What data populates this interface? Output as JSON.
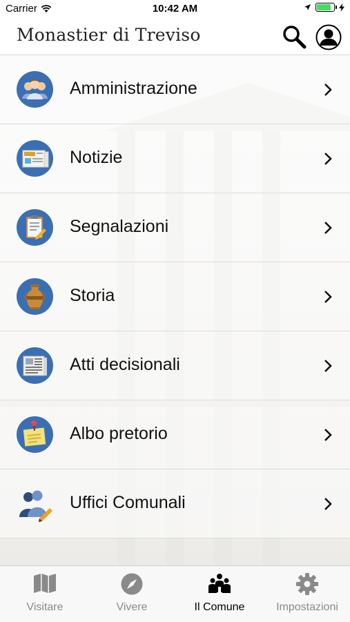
{
  "status_bar": {
    "carrier": "Carrier",
    "time": "10:42 AM"
  },
  "header": {
    "title": "Monastier di Treviso"
  },
  "menu": {
    "items": [
      {
        "label": "Amministrazione",
        "icon": "people-group-icon"
      },
      {
        "label": "Notizie",
        "icon": "newspaper-icon"
      },
      {
        "label": "Segnalazioni",
        "icon": "clipboard-pencil-icon"
      },
      {
        "label": "Storia",
        "icon": "amphora-icon"
      },
      {
        "label": "Atti decisionali",
        "icon": "document-icon"
      },
      {
        "label": "Albo pretorio",
        "icon": "pinned-note-icon"
      },
      {
        "label": "Uffici Comunali",
        "icon": "users-edit-icon"
      }
    ]
  },
  "tabbar": {
    "tabs": [
      {
        "label": "Visitare",
        "icon": "map-icon"
      },
      {
        "label": "Vivere",
        "icon": "compass-icon"
      },
      {
        "label": "Il Comune",
        "icon": "community-icon",
        "active": true
      },
      {
        "label": "Impostazioni",
        "icon": "gear-icon"
      }
    ]
  },
  "colors": {
    "icon_circle": "#3b6fb3",
    "tab_inactive": "#8a8a8a",
    "battery": "#4cd964"
  }
}
